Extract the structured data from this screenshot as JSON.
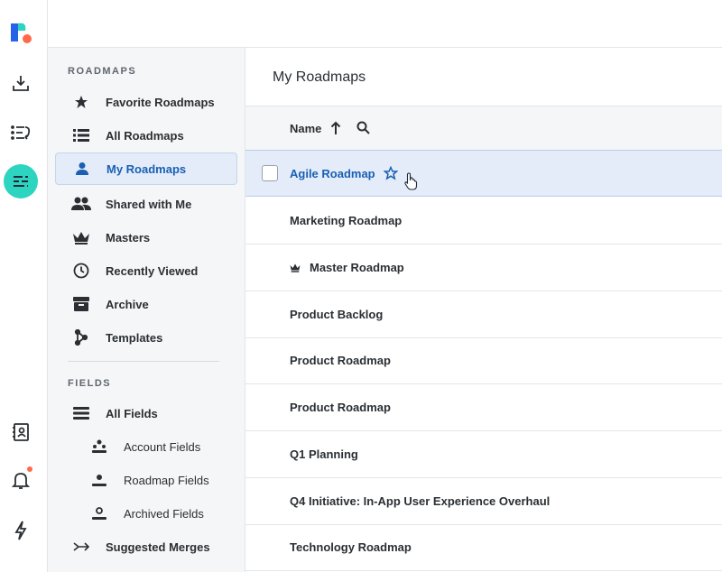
{
  "rail": {
    "icons": [
      "app-logo",
      "import-icon",
      "list-icon",
      "roadmaps-icon",
      "contacts-icon",
      "bell-icon",
      "lightning-icon"
    ],
    "accent_color": "#2dd4bf"
  },
  "sidebar": {
    "roadmaps_title": "ROADMAPS",
    "roadmaps_items": [
      {
        "label": "Favorite Roadmaps",
        "icon": "star-icon"
      },
      {
        "label": "All Roadmaps",
        "icon": "list-icon"
      },
      {
        "label": "My Roadmaps",
        "icon": "user-icon",
        "active": true
      },
      {
        "label": "Shared with Me",
        "icon": "users-icon"
      },
      {
        "label": "Masters",
        "icon": "crown-icon"
      },
      {
        "label": "Recently Viewed",
        "icon": "clock-icon"
      },
      {
        "label": "Archive",
        "icon": "archive-icon"
      },
      {
        "label": "Templates",
        "icon": "template-icon"
      }
    ],
    "fields_title": "FIELDS",
    "fields_items": [
      {
        "label": "All Fields",
        "icon": "fields-icon"
      },
      {
        "label": "Account Fields",
        "icon": "account-fields-icon"
      },
      {
        "label": "Roadmap Fields",
        "icon": "roadmap-fields-icon"
      },
      {
        "label": "Archived Fields",
        "icon": "archived-fields-icon"
      },
      {
        "label": "Suggested Merges",
        "icon": "merge-icon"
      }
    ]
  },
  "main": {
    "title": "My Roadmaps",
    "column_header": "Name",
    "rows": [
      {
        "name": "Agile Roadmap",
        "selected": true,
        "favorite_star": true
      },
      {
        "name": "Marketing Roadmap"
      },
      {
        "name": "Master Roadmap",
        "master": true
      },
      {
        "name": "Product Backlog"
      },
      {
        "name": "Product Roadmap"
      },
      {
        "name": "Product Roadmap"
      },
      {
        "name": "Q1 Planning"
      },
      {
        "name": "Q4 Initiative: In-App User Experience Overhaul"
      },
      {
        "name": "Technology Roadmap"
      }
    ]
  },
  "colors": {
    "selected_row_bg": "#e3ecf8",
    "selected_text": "#1a5fb4",
    "notification_dot": "#ff6b4a"
  }
}
